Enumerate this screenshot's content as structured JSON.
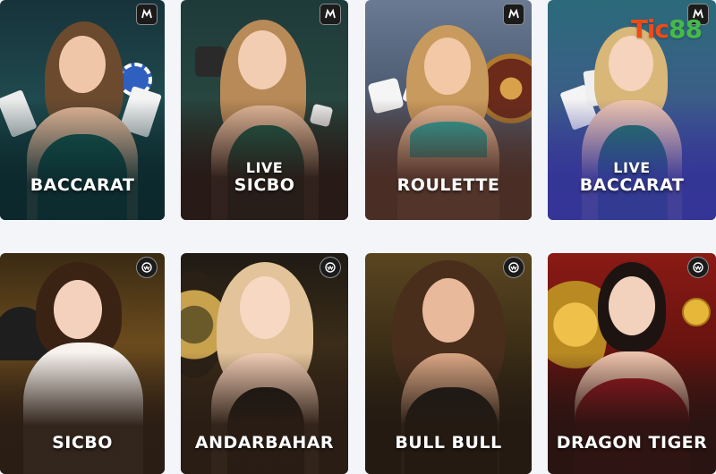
{
  "brand": {
    "logo_part1": "Tic",
    "logo_part2": "88",
    "color1": "#f24a17",
    "color2": "#46b94a"
  },
  "games_row1": [
    {
      "line1": "",
      "title": "BACCARAT"
    },
    {
      "line1": "LIVE",
      "title": "SICBO"
    },
    {
      "line1": "",
      "title": "ROULETTE"
    },
    {
      "line1": "LIVE",
      "title": "BACCARAT"
    }
  ],
  "games_row2": [
    {
      "title": "SICBO"
    },
    {
      "title": "ANDARBAHAR"
    },
    {
      "title": "BULL BULL"
    },
    {
      "title": "DRAGON TIGER"
    }
  ],
  "provider_icons": [
    "microgaming-logo-icon",
    "wm-casino-logo-icon"
  ]
}
